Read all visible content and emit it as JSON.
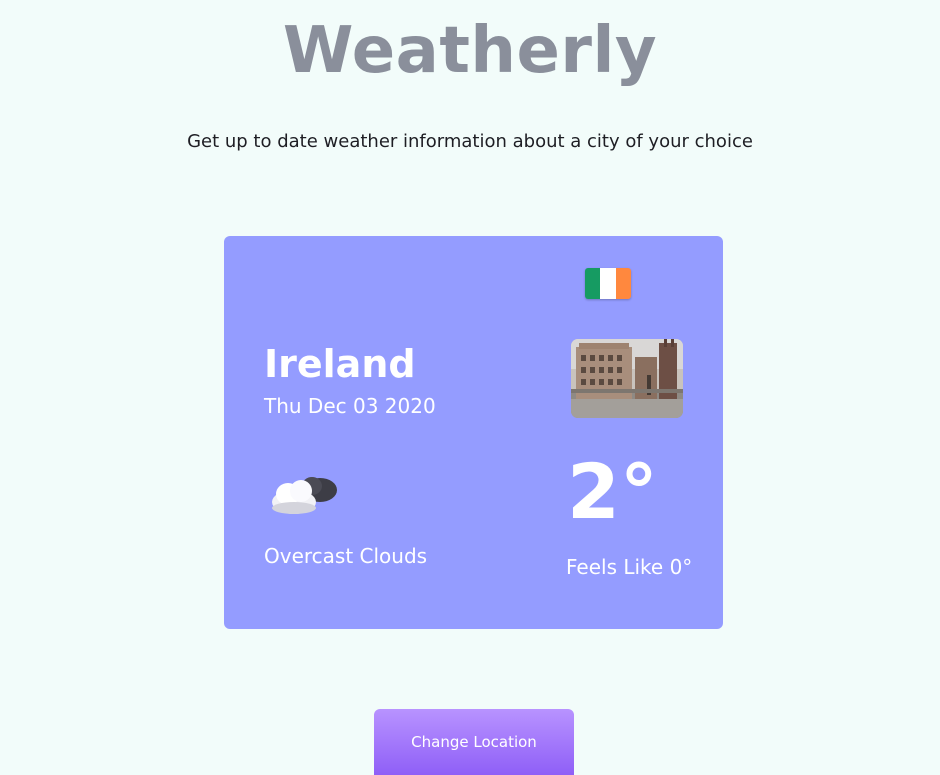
{
  "app": {
    "title": "Weatherly",
    "tagline": "Get up to date weather information about a city of your choice"
  },
  "weather": {
    "location": "Ireland",
    "date": "Thu Dec 03 2020",
    "condition": "Overcast Clouds",
    "condition_icon": "cloud-icon",
    "temperature": "2°",
    "feels_like": "Feels Like 0°",
    "flag_icon": "ireland-flag-icon",
    "photo": "city-building-photo"
  },
  "actions": {
    "change_location_label": "Change Location"
  },
  "colors": {
    "background": "#f2fcfa",
    "card": "#949cff",
    "title": "#8a8f9b",
    "button_top": "#b893ff",
    "button_bottom": "#8f5ff7",
    "flag_green": "#169b62",
    "flag_white": "#ffffff",
    "flag_orange": "#ff883e"
  }
}
